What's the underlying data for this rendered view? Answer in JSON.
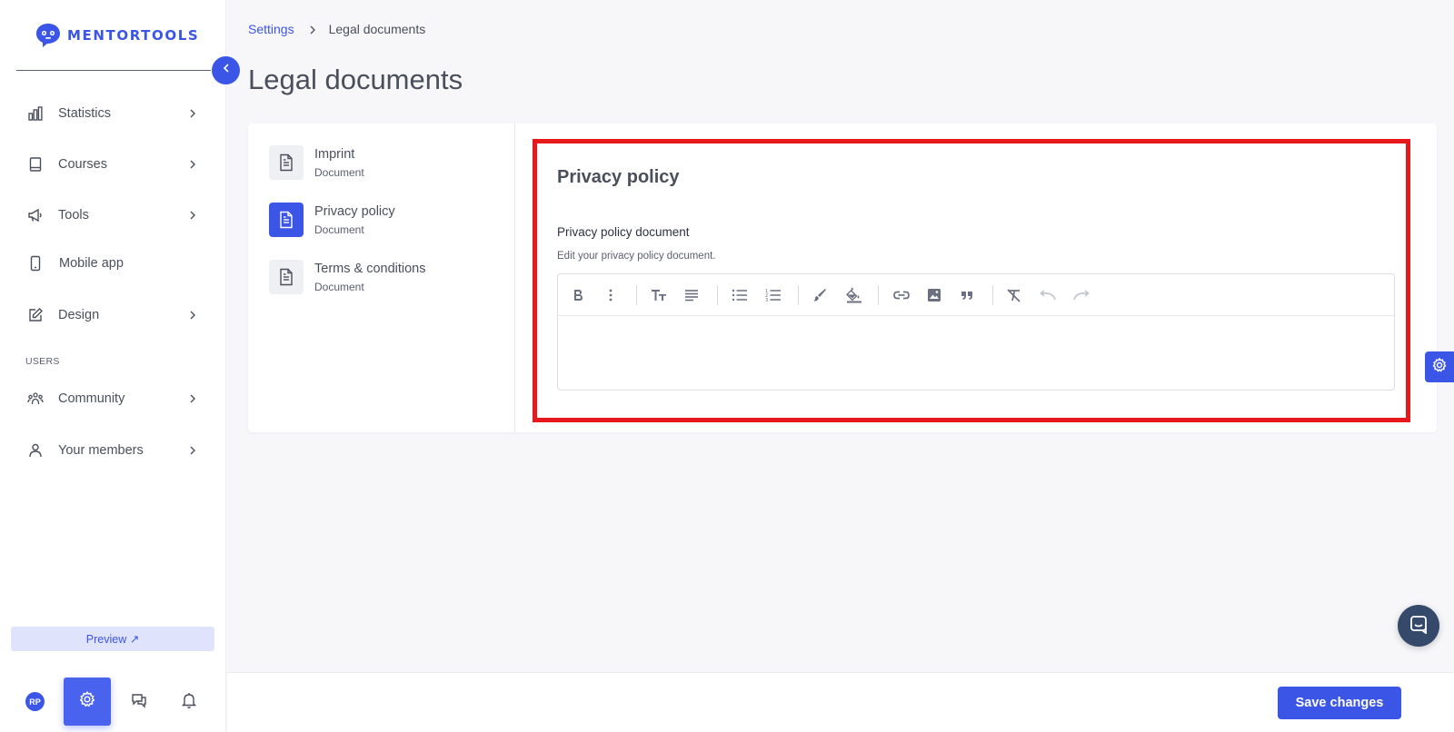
{
  "brand": {
    "name": "MENTORTOOLS",
    "color": "#3b55e6"
  },
  "sidebar": {
    "items": [
      {
        "label": "Statistics",
        "icon": "bar-chart-icon",
        "has_chevron": true
      },
      {
        "label": "Courses",
        "icon": "book-icon",
        "has_chevron": true
      },
      {
        "label": "Tools",
        "icon": "megaphone-icon",
        "has_chevron": true
      },
      {
        "label": "Mobile app",
        "icon": "mobile-icon",
        "has_chevron": false
      },
      {
        "label": "Design",
        "icon": "pencil-icon",
        "has_chevron": true
      }
    ],
    "section_users": "USERS",
    "user_items": [
      {
        "label": "Community",
        "icon": "community-icon",
        "has_chevron": true
      },
      {
        "label": "Your members",
        "icon": "user-icon",
        "has_chevron": true
      }
    ],
    "preview_label": "Preview ↗",
    "avatar_initials": "RP"
  },
  "breadcrumb": {
    "parent": "Settings",
    "current": "Legal documents"
  },
  "page_title": "Legal documents",
  "documents": [
    {
      "title": "Imprint",
      "subtitle": "Document",
      "active": false
    },
    {
      "title": "Privacy policy",
      "subtitle": "Document",
      "active": true
    },
    {
      "title": "Terms & conditions",
      "subtitle": "Document",
      "active": false
    }
  ],
  "editor_section": {
    "title": "Privacy policy",
    "field_label": "Privacy policy document",
    "field_help": "Edit your privacy policy document.",
    "content": ""
  },
  "footer": {
    "save_label": "Save changes"
  },
  "colors": {
    "accent": "#3b55e6",
    "highlight": "#e8191c",
    "chat": "#354a6b"
  }
}
